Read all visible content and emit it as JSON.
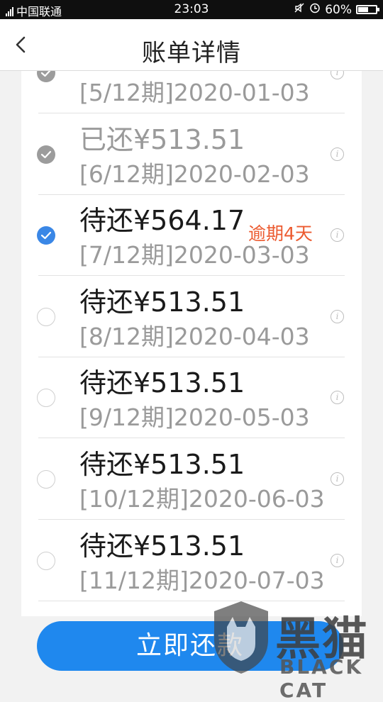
{
  "status_bar": {
    "network": "4G",
    "carrier": "中国联通",
    "time": "23:03",
    "battery": "60%",
    "battery_level": 0.6
  },
  "header": {
    "title": "账单详情",
    "back_icon": "chevron-left-icon"
  },
  "installments": [
    {
      "status": "paid",
      "amount": "已还¥513.51",
      "period": "[5/12期]2020-01-03",
      "overdue": ""
    },
    {
      "status": "paid",
      "amount": "已还¥513.51",
      "period": "[6/12期]2020-02-03",
      "overdue": ""
    },
    {
      "status": "selected",
      "amount": "待还¥564.17",
      "period": "[7/12期]2020-03-03",
      "overdue": "逾期4天"
    },
    {
      "status": "unselected",
      "amount": "待还¥513.51",
      "period": "[8/12期]2020-04-03",
      "overdue": ""
    },
    {
      "status": "unselected",
      "amount": "待还¥513.51",
      "period": "[9/12期]2020-05-03",
      "overdue": ""
    },
    {
      "status": "unselected",
      "amount": "待还¥513.51",
      "period": "[10/12期]2020-06-03",
      "overdue": ""
    },
    {
      "status": "unselected",
      "amount": "待还¥513.51",
      "period": "[11/12期]2020-07-03",
      "overdue": ""
    }
  ],
  "info_icon_glyph": "i",
  "pay_button": {
    "label": "立即还款"
  },
  "watermark": {
    "text": "黑猫",
    "sub": "BLACK CAT"
  },
  "colors": {
    "accent": "#1f88ee",
    "selected_check": "#3a87e6",
    "overdue": "#ec5a2f",
    "paid_text": "#9a9a9a"
  }
}
